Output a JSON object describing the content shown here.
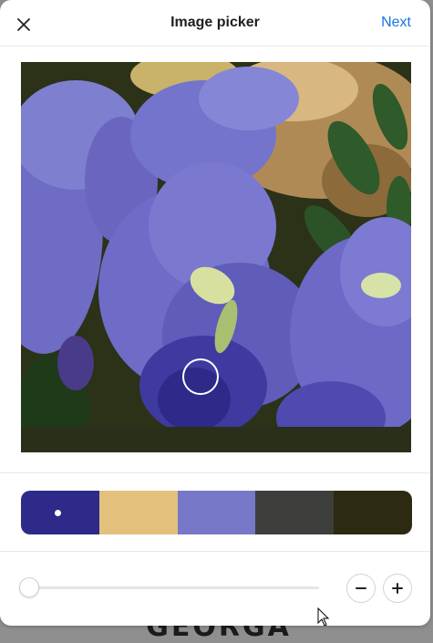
{
  "header": {
    "title": "Image picker",
    "next_label": "Next",
    "close_icon": "close-icon"
  },
  "background": {
    "partial_text": "GEORGA"
  },
  "image": {
    "subject": "blue-violet pea flowers",
    "picker_color": "#2d2a8a"
  },
  "palette": {
    "swatches": [
      {
        "color": "#2d2a8a",
        "selected": true
      },
      {
        "color": "#e3c07c",
        "selected": false
      },
      {
        "color": "#7878c8",
        "selected": false
      },
      {
        "color": "#3e3e3c",
        "selected": false
      },
      {
        "color": "#2d2a12",
        "selected": false
      }
    ]
  },
  "zoom": {
    "level": 0,
    "zoom_out_icon": "minus-icon",
    "zoom_in_icon": "plus-icon"
  }
}
